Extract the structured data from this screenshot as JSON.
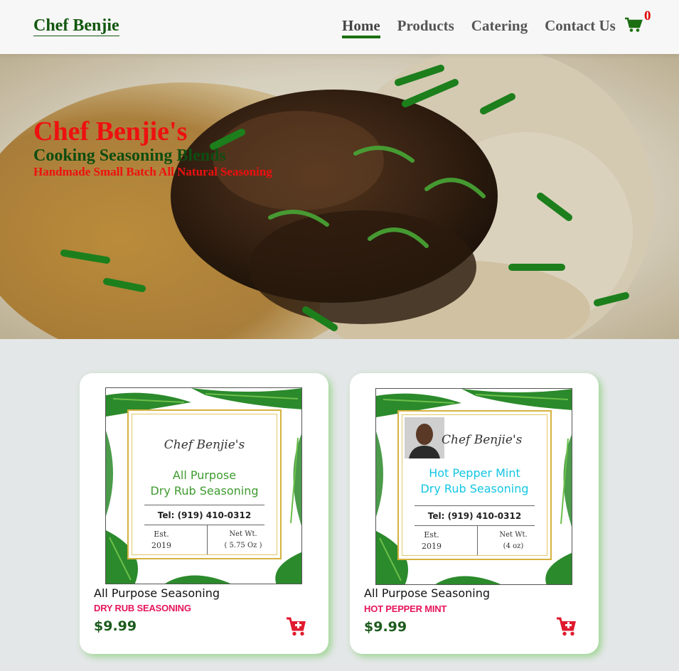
{
  "nav": {
    "brand": "Chef Benjie",
    "links": [
      {
        "label": "Home",
        "active": true
      },
      {
        "label": "Products",
        "active": false
      },
      {
        "label": "Catering",
        "active": false
      },
      {
        "label": "Contact Us",
        "active": false
      }
    ],
    "cart_count": "0",
    "cart_icon": "shopping-cart-icon"
  },
  "hero": {
    "title": "Chef Benjie's",
    "subtitle": "Cooking Seasoning Blends",
    "tagline": "Handmade Small Batch All Natural Seasoning"
  },
  "products": [
    {
      "title": "All Purpose Seasoning",
      "subtitle": "DRY RUB SEASONING",
      "price": "$9.99",
      "label": {
        "brand": "Chef Benjie's",
        "name_line1": "All Purpose",
        "name_line2": "Dry Rub Seasoning",
        "tel": "Tel: (919) 410-0312",
        "est_label": "Est.",
        "est_year": "2019",
        "net_label": "Net Wt.",
        "net_value": "( 5.75 Oz )"
      }
    },
    {
      "title": "All Purpose Seasoning",
      "subtitle": "HOT PEPPER MINT",
      "price": "$9.99",
      "label": {
        "brand": "Chef Benjie's",
        "name_line1": "Hot Pepper Mint",
        "name_line2": "Dry Rub Seasoning",
        "tel": "Tel: (919) 410-0312",
        "est_label": "Est.",
        "est_year": "2019",
        "net_label": "Net Wt.",
        "net_value": "(4 oz)"
      }
    }
  ],
  "colors": {
    "brand_green": "#12570f",
    "accent_red": "#ee1010",
    "price_green": "#1c5a1c",
    "subtitle_pink": "#e5155c",
    "card_shadow": "#46be28"
  }
}
